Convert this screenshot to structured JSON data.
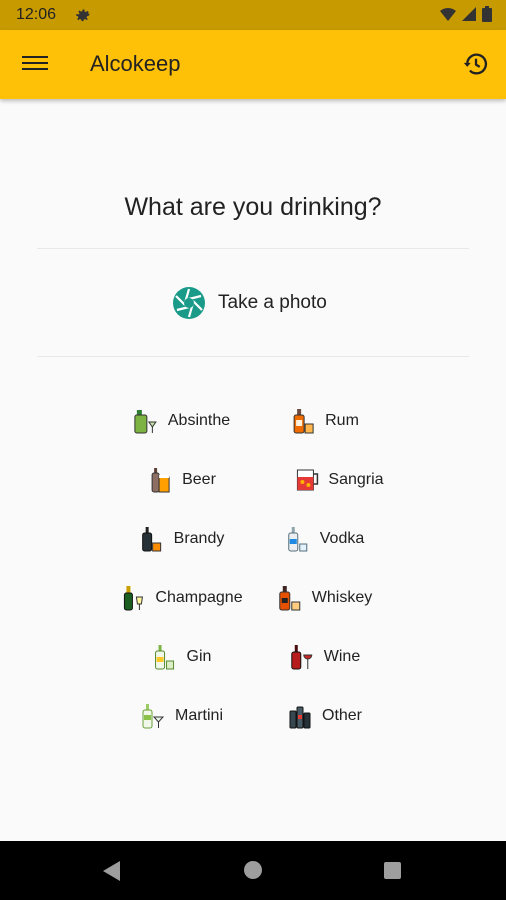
{
  "status_bar": {
    "time": "12:06"
  },
  "app_bar": {
    "title": "Alcokeep"
  },
  "main": {
    "question": "What are you drinking?",
    "take_photo_label": "Take a photo"
  },
  "drinks": [
    {
      "label": "Absinthe",
      "icon": "absinthe-icon"
    },
    {
      "label": "Rum",
      "icon": "rum-icon"
    },
    {
      "label": "Beer",
      "icon": "beer-icon"
    },
    {
      "label": "Sangria",
      "icon": "sangria-icon"
    },
    {
      "label": "Brandy",
      "icon": "brandy-icon"
    },
    {
      "label": "Vodka",
      "icon": "vodka-icon"
    },
    {
      "label": "Champagne",
      "icon": "champagne-icon"
    },
    {
      "label": "Whiskey",
      "icon": "whiskey-icon"
    },
    {
      "label": "Gin",
      "icon": "gin-icon"
    },
    {
      "label": "Wine",
      "icon": "wine-icon"
    },
    {
      "label": "Martini",
      "icon": "martini-icon"
    },
    {
      "label": "Other",
      "icon": "other-drinks-icon"
    }
  ],
  "colors": {
    "accent": "#ffc107",
    "status_bar": "#c79a00",
    "camera_icon": "#1a9b8a"
  }
}
